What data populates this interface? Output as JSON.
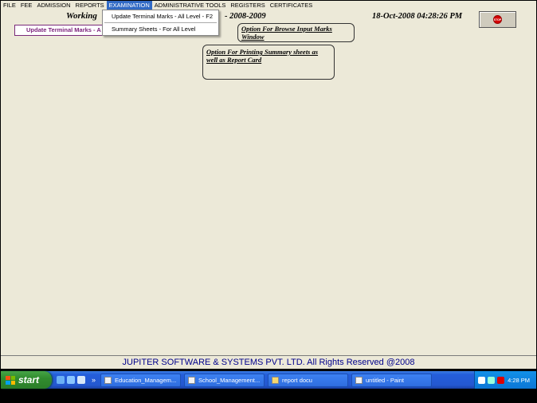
{
  "menu": [
    "FILE",
    "FEE",
    "ADMISSION",
    "REPORTS",
    "EXAMINATION",
    "ADMINISTRATIVE TOOLS",
    "REGISTERS",
    "CERTIFICATES"
  ],
  "header": {
    "working": "Working",
    "year": "- 2008-2009",
    "datetime": "18-Oct-2008 04:28:26 PM",
    "stop_label": "STOP"
  },
  "update_tab": "Update Terminal Marks - A",
  "dropdown": {
    "item1": "Update Terminal Marks - All Level -   F2",
    "item2": "Summary Sheets - For All Level"
  },
  "callouts": {
    "c1": "Option For Browse Input Marks Window",
    "c2": "Option For Printing Summary sheets as well as Report Card"
  },
  "footer": "JUPITER SOFTWARE & SYSTEMS PVT. LTD. All Rights Reserved @2008",
  "taskbar": {
    "start": "start",
    "chevron": "»",
    "tasks": [
      "Education_Managem...",
      "School_Management...",
      "report docu",
      "untitled - Paint"
    ],
    "clock": "4:28 PM"
  },
  "colors": {
    "menu_active": "#316ac5",
    "footer_text": "#00008b",
    "app_bg": "#ece9d8"
  }
}
